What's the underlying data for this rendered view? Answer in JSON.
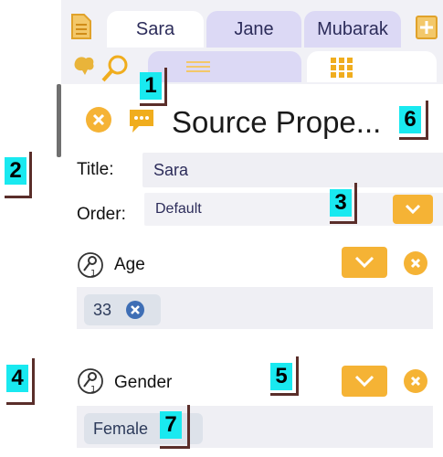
{
  "tabs": [
    {
      "label": "Sara",
      "active": true
    },
    {
      "label": "Jane",
      "active": false
    },
    {
      "label": "Mubarak",
      "active": false
    }
  ],
  "header": {
    "title": "Source Prope..."
  },
  "title_field": {
    "label": "Title:",
    "value": "Sara"
  },
  "order_field": {
    "label": "Order:",
    "value": "Default"
  },
  "properties": [
    {
      "label": "Age",
      "values": [
        "33"
      ]
    },
    {
      "label": "Gender",
      "values": [
        "Female"
      ]
    }
  ],
  "callouts": [
    "1",
    "2",
    "3",
    "4",
    "5",
    "6",
    "7"
  ],
  "colors": {
    "accent": "#f5b335",
    "tab_inactive": "#dcd9f5",
    "field_bg": "#efeff4",
    "callout": "#19e9f0",
    "chip_x": "#3e6eb5"
  },
  "icons": [
    "document-icon",
    "add-icon",
    "map-icon",
    "search-icon",
    "list-icon",
    "grid-icon",
    "close-icon",
    "chat-icon",
    "key-icon",
    "chevron-down-icon"
  ]
}
